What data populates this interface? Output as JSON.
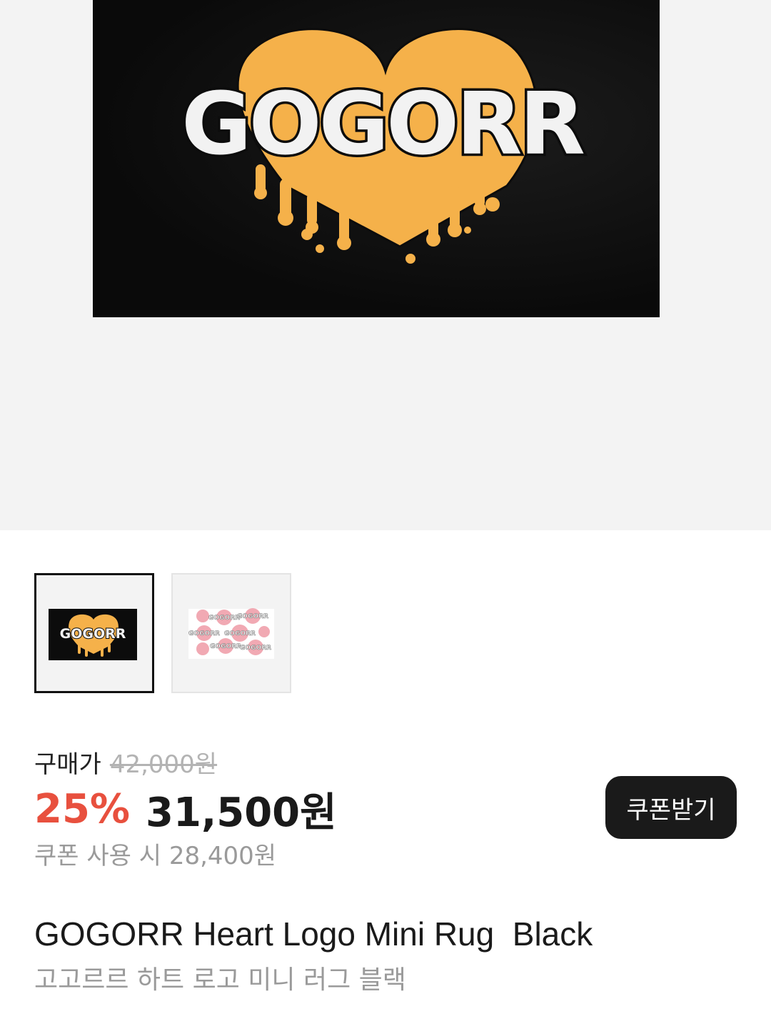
{
  "hero": {
    "logo_text": "GOGORR",
    "background_color": "#f3f3f3",
    "rug_color": "#0c0c0c",
    "heart_color": "#f5b14a"
  },
  "thumbnails": [
    {
      "logo_text": "GOGORR",
      "selected": true,
      "style": "black"
    },
    {
      "logo_text": "GOGORR",
      "selected": false,
      "style": "pink-pattern"
    }
  ],
  "price": {
    "label": "구매가",
    "original": "42,000원",
    "discount": "25%",
    "sale": "31,500원",
    "coupon_button": "쿠폰받기",
    "coupon_price": "쿠폰 사용 시 28,400원",
    "discount_color": "#e8503e"
  },
  "product": {
    "title": "GOGORR Heart Logo Mini Rug  Black",
    "subtitle": "고고르르 하트 로고 미니 러그 블랙"
  }
}
